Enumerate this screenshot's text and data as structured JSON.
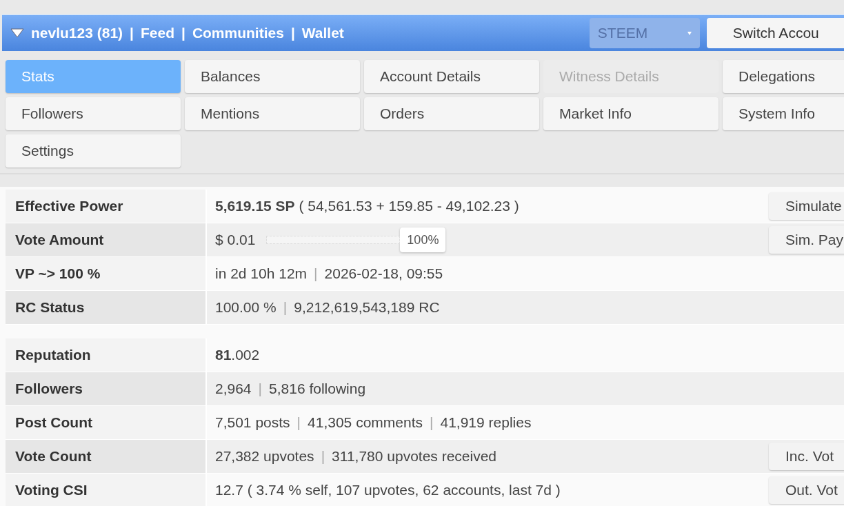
{
  "header": {
    "user": "nevlu123 (81)",
    "links": [
      "Feed",
      "Communities",
      "Wallet"
    ],
    "separator": "|",
    "currency": "STEEM",
    "switch_button": "Switch Accou"
  },
  "tabs": [
    {
      "label": "Stats",
      "selected": true,
      "disabled": false
    },
    {
      "label": "Balances",
      "selected": false,
      "disabled": false
    },
    {
      "label": "Account Details",
      "selected": false,
      "disabled": false
    },
    {
      "label": "Witness Details",
      "selected": false,
      "disabled": true
    },
    {
      "label": "Delegations",
      "selected": false,
      "disabled": false
    },
    {
      "label": "Followers",
      "selected": false,
      "disabled": false
    },
    {
      "label": "Mentions",
      "selected": false,
      "disabled": false
    },
    {
      "label": "Orders",
      "selected": false,
      "disabled": false
    },
    {
      "label": "Market Info",
      "selected": false,
      "disabled": false
    },
    {
      "label": "System Info",
      "selected": false,
      "disabled": false
    },
    {
      "label": "Settings",
      "selected": false,
      "disabled": false
    }
  ],
  "value_separator": "|",
  "sections": [
    {
      "rows": [
        {
          "label": "Effective Power",
          "kind": "text",
          "parts": [
            "**5,619.15 SP** ( 54,561.53 + 159.85 - 49,102.23 )"
          ],
          "button": "Simulate"
        },
        {
          "label": "Vote Amount",
          "kind": "slider",
          "parts": [
            "$ 0.01"
          ],
          "level": 1,
          "reading": "100%",
          "button": "Sim. Pay"
        },
        {
          "label": "VP ~> 100 %",
          "kind": "text",
          "parts": [
            "in 2d 10h 12m",
            "2026-02-18, 09:55"
          ]
        },
        {
          "label": "RC Status",
          "kind": "text",
          "parts": [
            "100.00 %",
            "9,212,619,543,189 RC"
          ]
        }
      ]
    },
    {
      "rows": [
        {
          "label": "Reputation",
          "kind": "text",
          "parts": [
            "**81**.002"
          ]
        },
        {
          "label": "Followers",
          "kind": "text",
          "parts": [
            "2,964",
            "5,816 following"
          ]
        },
        {
          "label": "Post Count",
          "kind": "text",
          "parts": [
            "7,501 posts",
            "41,305 comments",
            "41,919 replies"
          ]
        },
        {
          "label": "Vote Count",
          "kind": "text",
          "parts": [
            "27,382 upvotes",
            "311,780 upvotes received"
          ],
          "button": "Inc. Vot"
        },
        {
          "label": "Voting CSI",
          "kind": "text",
          "parts": [
            "12.7 ( 3.74 % self, 107 upvotes, 62 accounts, last 7d )"
          ],
          "button": "Out. Vot"
        }
      ]
    }
  ]
}
